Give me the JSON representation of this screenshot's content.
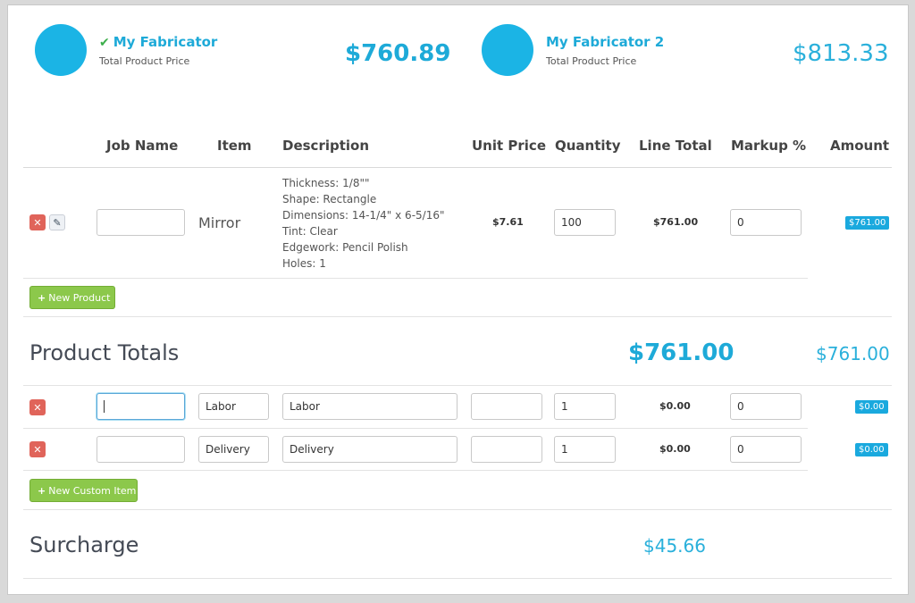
{
  "fabricators": [
    {
      "name": "My Fabricator",
      "subtitle": "Total Product Price",
      "price": "$760.89",
      "selected": true,
      "check_icon": "check-icon"
    },
    {
      "name": "My Fabricator 2",
      "subtitle": "Total Product Price",
      "price": "$813.33",
      "selected": false
    }
  ],
  "table_headers": [
    "Job Name",
    "Item",
    "Description",
    "Unit Price",
    "Quantity",
    "Line Total",
    "Markup %",
    "Amount"
  ],
  "products": [
    {
      "job_name": "",
      "item": "Mirror",
      "description": [
        "Thickness: 1/8\"\"",
        "Shape: Rectangle",
        "Dimensions: 14-1/4\" x 6-5/16\"",
        "Tint: Clear",
        "Edgework: Pencil Polish",
        "Holes: 1"
      ],
      "unit_price": "$7.61",
      "quantity": "100",
      "line_total": "$761.00",
      "markup": "0",
      "amount": "$761.00"
    }
  ],
  "new_product_label": "New Product",
  "product_totals": {
    "label": "Product Totals",
    "value_bold": "$761.00",
    "value_light": "$761.00"
  },
  "custom_items": [
    {
      "job_name": "",
      "item": "Labor",
      "description": "Labor",
      "unit_price": "",
      "quantity": "1",
      "line_total": "$0.00",
      "markup": "0",
      "amount": "$0.00"
    },
    {
      "job_name": "",
      "item": "Delivery",
      "description": "Delivery",
      "unit_price": "",
      "quantity": "1",
      "line_total": "$0.00",
      "markup": "0",
      "amount": "$0.00"
    }
  ],
  "new_custom_item_label": "New Custom Item",
  "surcharge": {
    "label": "Surcharge",
    "value": "$45.66"
  },
  "colors": {
    "accent": "#1eaad8",
    "avatar": "#1bb4e5",
    "delete": "#e0645a",
    "add": "#8cc84b",
    "check": "#3cae4b"
  }
}
